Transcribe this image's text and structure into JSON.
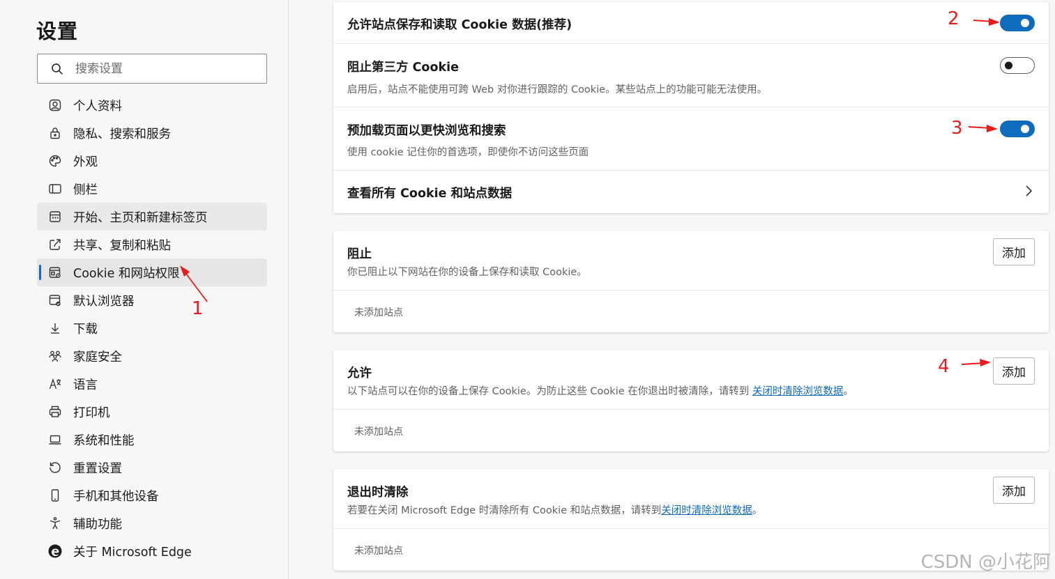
{
  "sidebar": {
    "title": "设置",
    "search_placeholder": "搜索设置",
    "items": [
      {
        "label": "个人资料",
        "icon": "profile-icon"
      },
      {
        "label": "隐私、搜索和服务",
        "icon": "lock-icon"
      },
      {
        "label": "外观",
        "icon": "palette-icon"
      },
      {
        "label": "侧栏",
        "icon": "sidebar-icon"
      },
      {
        "label": "开始、主页和新建标签页",
        "icon": "home-grid-icon"
      },
      {
        "label": "共享、复制和粘贴",
        "icon": "share-icon"
      },
      {
        "label": "Cookie 和网站权限",
        "icon": "cookie-settings-icon"
      },
      {
        "label": "默认浏览器",
        "icon": "default-browser-icon"
      },
      {
        "label": "下载",
        "icon": "download-icon"
      },
      {
        "label": "家庭安全",
        "icon": "family-icon"
      },
      {
        "label": "语言",
        "icon": "language-icon"
      },
      {
        "label": "打印机",
        "icon": "printer-icon"
      },
      {
        "label": "系统和性能",
        "icon": "laptop-icon"
      },
      {
        "label": "重置设置",
        "icon": "reset-icon"
      },
      {
        "label": "手机和其他设备",
        "icon": "phone-icon"
      },
      {
        "label": "辅助功能",
        "icon": "accessibility-icon"
      },
      {
        "label": "关于 Microsoft Edge",
        "icon": "edge-logo-icon"
      }
    ]
  },
  "cookie_card": {
    "allow_save": {
      "title": "允许站点保存和读取 Cookie 数据(推荐)",
      "enabled": true
    },
    "block_third_party": {
      "title": "阻止第三方 Cookie",
      "desc": "启用后，站点不能使用可跨 Web 对你进行跟踪的 Cookie。某些站点上的功能可能无法使用。",
      "enabled": false
    },
    "preload": {
      "title": "预加载页面以更快浏览和搜索",
      "desc": "使用 cookie 记住你的首选项，即使你不访问这些页面",
      "enabled": true
    },
    "view_all": {
      "title": "查看所有 Cookie 和站点数据"
    }
  },
  "block_card": {
    "title": "阻止",
    "desc": "你已阻止以下网站在你的设备上保存和读取 Cookie。",
    "add_label": "添加",
    "empty": "未添加站点"
  },
  "allow_card": {
    "title": "允许",
    "desc_prefix": "以下站点可以在你的设备上保存 Cookie。为防止这些 Cookie 在你退出时被清除，请转到 ",
    "link": "关闭时清除浏览数据",
    "desc_suffix": "。",
    "add_label": "添加",
    "empty": "未添加站点"
  },
  "clear_card": {
    "title": "退出时清除",
    "desc_prefix": "若要在关闭 Microsoft Edge 时清除所有 Cookie 和站点数据，请转到",
    "link": "关闭时清除浏览数据",
    "desc_suffix": "。",
    "add_label": "添加",
    "empty": "未添加站点"
  },
  "annotations": [
    "1",
    "2",
    "3",
    "4"
  ],
  "annotation_color": "#e81c1c",
  "accent_color": "#0f6cbd",
  "watermark": "CSDN @小花阿"
}
